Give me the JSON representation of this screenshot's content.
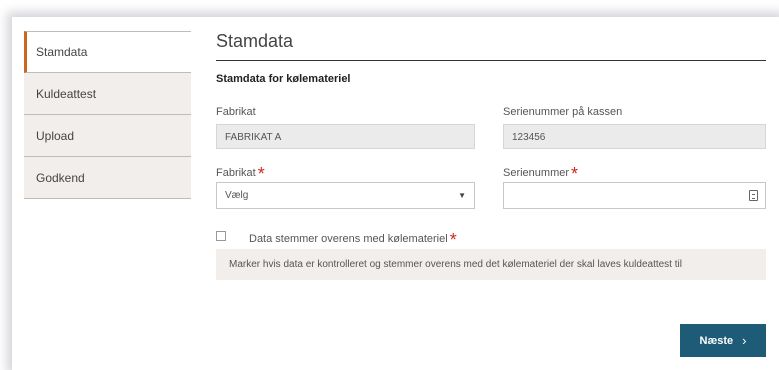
{
  "sidebar": {
    "items": [
      {
        "label": "Stamdata"
      },
      {
        "label": "Kuldeattest"
      },
      {
        "label": "Upload"
      },
      {
        "label": "Godkend"
      }
    ]
  },
  "main": {
    "title": "Stamdata",
    "section_title": "Stamdata for kølemateriel",
    "fabrikat_ro_label": "Fabrikat",
    "fabrikat_ro_value": "FABRIKAT A",
    "serienr_ro_label": "Serienummer på kassen",
    "serienr_ro_value": "123456",
    "fabrikat_label": "Fabrikat",
    "fabrikat_select_value": "Vælg",
    "serienr_label": "Serienummer",
    "serienr_value": "",
    "required_mark": "*",
    "confirm_label": "Data stemmer overens med kølemateriel",
    "help_text": "Marker hvis data er kontrolleret og stemmer overens med det kølemateriel der skal laves kuldeattest til"
  },
  "footer": {
    "next_label": "Næste",
    "next_icon": "chevron-right-icon"
  },
  "colors": {
    "accent": "#c8691f",
    "primary_button": "#1e5b77",
    "required": "#d0291f",
    "sidebar_bg": "#f2eeec"
  }
}
